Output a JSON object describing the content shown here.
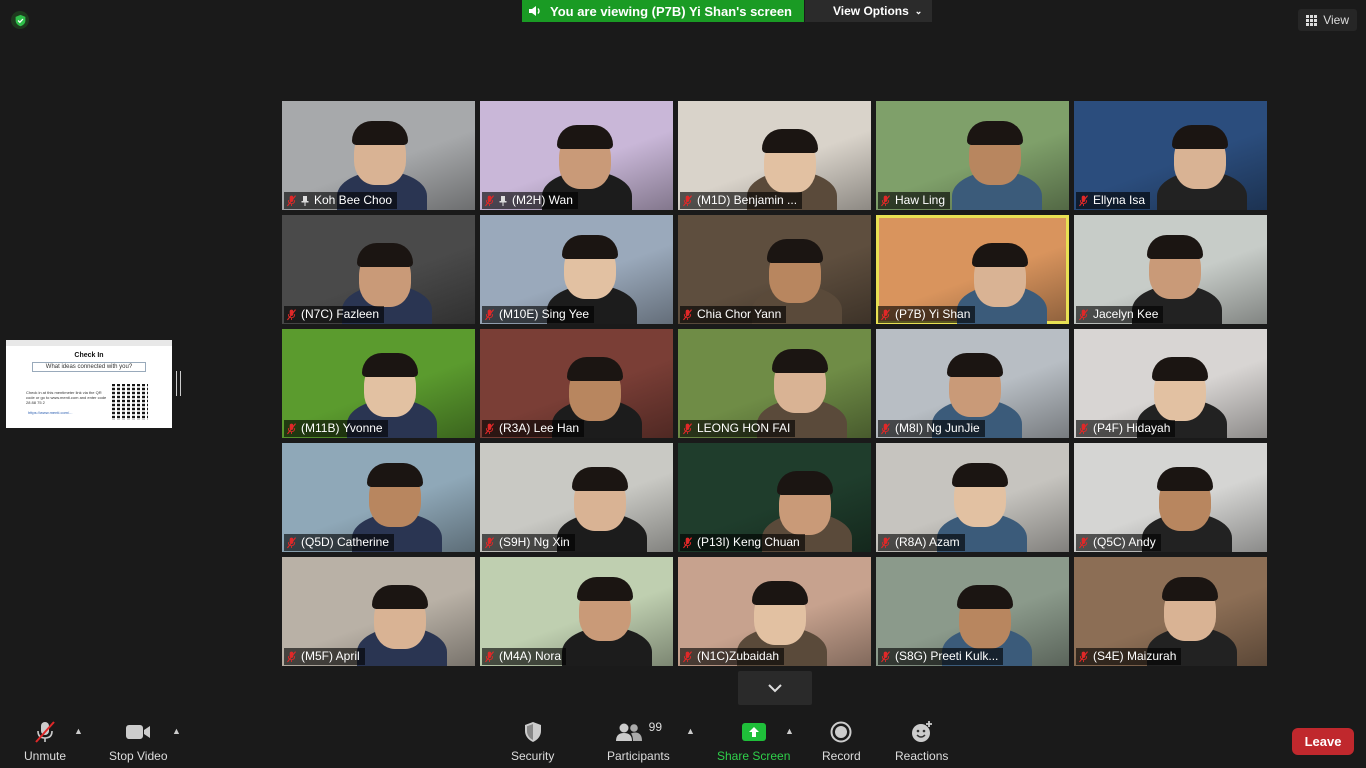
{
  "banner": {
    "text": "You are viewing (P7B) Yi Shan's screen",
    "view_options": "View Options"
  },
  "view_button": "View",
  "shared_screen": {
    "title": "Check In",
    "question": "What ideas connected with you?",
    "instructions": "Check in at this mentimeter link via the QR code or go to www.menti.com and enter code 28 88 75 2",
    "link": "https://www.menti.com/..."
  },
  "participants": [
    {
      "name": "Koh Bee Choo",
      "pinned": true,
      "bg": "#a7a9ab"
    },
    {
      "name": "(M2H) Wan",
      "pinned": true,
      "bg": "#c9b7d8"
    },
    {
      "name": "(M1D) Benjamin ...",
      "pinned": false,
      "bg": "#d9d3ca"
    },
    {
      "name": "Haw Ling",
      "pinned": false,
      "bg": "#7fa06a"
    },
    {
      "name": "Ellyna Isa",
      "pinned": false,
      "bg": "#2b4d7d"
    },
    {
      "name": "(N7C) Fazleen",
      "pinned": false,
      "bg": "#4a4a4a"
    },
    {
      "name": "(M10E) Sing Yee",
      "pinned": false,
      "bg": "#9aa9bb"
    },
    {
      "name": "Chia Chor Yann",
      "pinned": false,
      "bg": "#5e4e3e"
    },
    {
      "name": "(P7B) Yi Shan",
      "pinned": false,
      "bg": "#d9945d",
      "active": true
    },
    {
      "name": "Jacelyn Kee",
      "pinned": false,
      "bg": "#c7ccc8"
    },
    {
      "name": "(M11B) Yvonne",
      "pinned": false,
      "bg": "#5b9b2e"
    },
    {
      "name": "(R3A) Lee Han",
      "pinned": false,
      "bg": "#7a3e36"
    },
    {
      "name": "LEONG HON FAI",
      "pinned": false,
      "bg": "#6f8c46"
    },
    {
      "name": "(M8I) Ng JunJie",
      "pinned": false,
      "bg": "#b8bec4"
    },
    {
      "name": "(P4F) Hidayah",
      "pinned": false,
      "bg": "#d8d5d3"
    },
    {
      "name": "(Q5D) Catherine",
      "pinned": false,
      "bg": "#8fa8b8"
    },
    {
      "name": "(S9H) Ng Xin",
      "pinned": false,
      "bg": "#c9c9c4"
    },
    {
      "name": "(P13I) Keng Chuan",
      "pinned": false,
      "bg": "#1f3d2c"
    },
    {
      "name": "(R8A) Azam",
      "pinned": false,
      "bg": "#c6c4bf"
    },
    {
      "name": "(Q5C) Andy",
      "pinned": false,
      "bg": "#d5d5d3"
    },
    {
      "name": "(M5F) April",
      "pinned": false,
      "bg": "#b9b1a6"
    },
    {
      "name": "(M4A) Nora",
      "pinned": false,
      "bg": "#bfcfb0"
    },
    {
      "name": "(N1C)Zubaidah",
      "pinned": false,
      "bg": "#c7a28e"
    },
    {
      "name": "(S8G) Preeti Kulk...",
      "pinned": false,
      "bg": "#8b9a8b"
    },
    {
      "name": "(S4E) Maizurah",
      "pinned": false,
      "bg": "#8c6e55"
    }
  ],
  "toolbar": {
    "unmute": "Unmute",
    "stop_video": "Stop Video",
    "security": "Security",
    "participants": "Participants",
    "participants_count": "99",
    "share_screen": "Share Screen",
    "record": "Record",
    "reactions": "Reactions",
    "leave": "Leave"
  },
  "colors": {
    "share_green": "#1a9b24",
    "active_border": "#e8e053",
    "leave_red": "#c0282d",
    "mute_red": "#e02828"
  }
}
